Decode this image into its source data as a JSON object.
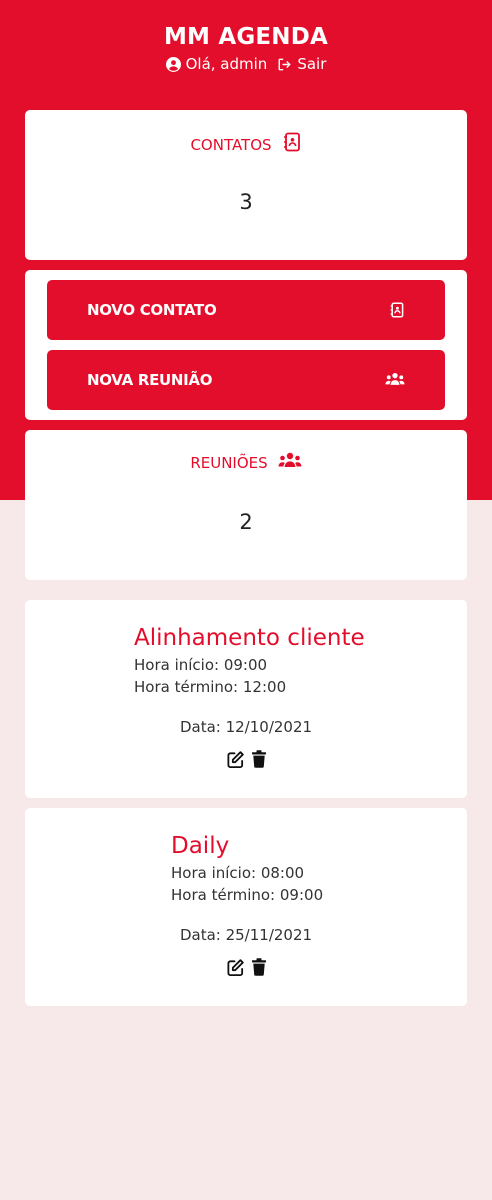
{
  "colors": {
    "accent": "#e30e2b",
    "background": "#f7e8e9",
    "card": "#ffffff"
  },
  "header": {
    "title": "MM AGENDA",
    "greeting": "Olá, admin",
    "greeting_icon": "user-circle-icon",
    "logout_label": "Sair",
    "logout_icon": "sign-out-icon"
  },
  "contacts_card": {
    "title": "CONTATOS",
    "icon": "address-book-icon",
    "count": "3"
  },
  "actions": {
    "new_contact_label": "NOVO CONTATO",
    "new_contact_icon": "address-book-icon",
    "new_meeting_label": "NOVA REUNIÃO",
    "new_meeting_icon": "users-icon"
  },
  "meetings_card": {
    "title": "REUNIÕES",
    "icon": "users-icon",
    "count": "2"
  },
  "meetings": [
    {
      "title": "Alinhamento cliente",
      "start": "Hora início: 09:00",
      "end": "Hora término: 12:00",
      "date": "Data: 12/10/2021"
    },
    {
      "title": "Daily",
      "start": "Hora início: 08:00",
      "end": "Hora término: 09:00",
      "date": "Data: 25/11/2021"
    }
  ]
}
